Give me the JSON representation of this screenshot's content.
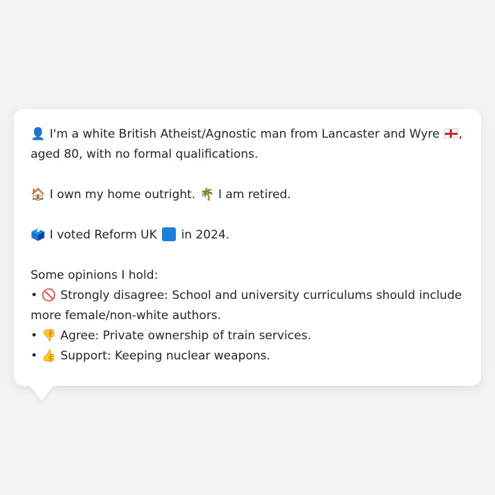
{
  "profile": {
    "intro_icon": "👤",
    "intro_text_1": "I'm a white British Atheist/Agnostic man from Lancaster and Wyre",
    "intro_flag_icon": "england-flag-icon",
    "intro_text_2": ",",
    "intro_text_3": "aged 80, with no formal qualifications.",
    "home_icon": "🏠",
    "home_text": "I own my home outright.",
    "retired_icon": "🌴",
    "retired_text": "I am retired.",
    "vote_icon": "🗳️",
    "vote_text_1": "I voted Reform UK",
    "vote_party_icon": "blue-square-icon",
    "vote_text_2": "in 2024.",
    "opinions_heading": "Some opinions I hold:",
    "opinions": [
      {
        "bullet": "•",
        "icon": "🚫",
        "text": "Strongly disagree: School and university curriculums should include more female/non-white authors."
      },
      {
        "bullet": "•",
        "icon": "👎",
        "text": "Agree: Private ownership of train services."
      },
      {
        "bullet": "•",
        "icon": "👍",
        "text": "Support: Keeping nuclear weapons."
      }
    ]
  },
  "colors": {
    "background": "#f2f3f5",
    "bubble": "#ffffff",
    "text": "#1e2433",
    "party_blue": "#1d7ee0"
  }
}
